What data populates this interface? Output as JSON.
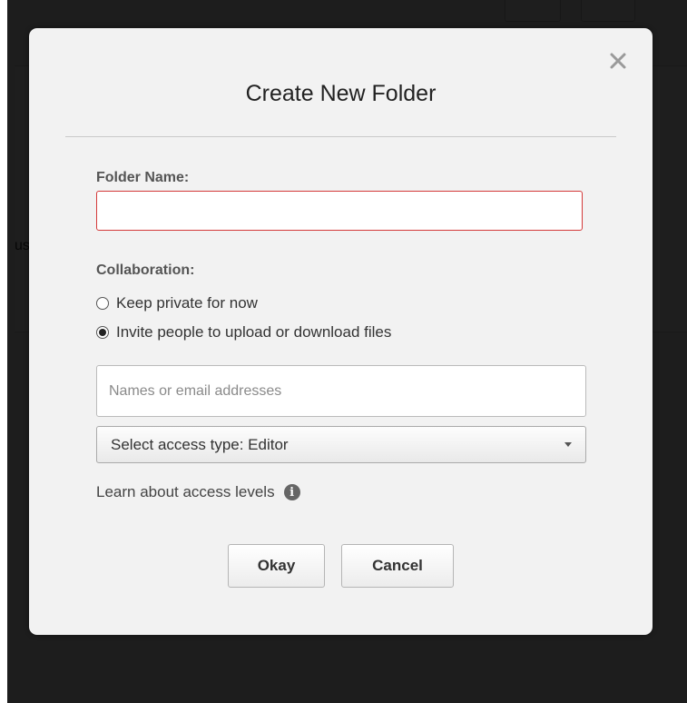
{
  "background": {
    "fragment_text": "us"
  },
  "dialog": {
    "title": "Create New Folder",
    "close_icon": "close-icon",
    "folder_name_label": "Folder Name:",
    "folder_name_value": "",
    "collaboration_label": "Collaboration:",
    "options": [
      {
        "label": "Keep private for now",
        "selected": false
      },
      {
        "label": "Invite people to upload or download files",
        "selected": true
      }
    ],
    "names_placeholder": "Names or email addresses",
    "access_select_value": "Select access type: Editor",
    "learn_link": "Learn about access levels",
    "info_icon": "info-icon",
    "okay_label": "Okay",
    "cancel_label": "Cancel",
    "colors": {
      "error_border": "#d43a3a",
      "dialog_bg": "#f2f2f2"
    }
  }
}
